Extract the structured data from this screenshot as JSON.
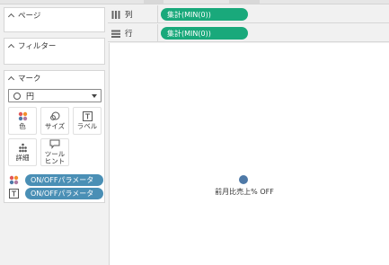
{
  "panels": {
    "pages": {
      "title": "ページ"
    },
    "filters": {
      "title": "フィルター"
    },
    "marks": {
      "title": "マーク",
      "mark_type": "円",
      "buttons": {
        "color": "色",
        "size": "サイズ",
        "label": "ラベル",
        "detail": "詳細",
        "tooltip": "ツールヒント"
      },
      "fields": [
        {
          "icon": "color-dots-icon",
          "label": "ON/OFFパラメータ"
        },
        {
          "icon": "text-label-icon",
          "label": "ON/OFFパラメータ"
        }
      ]
    }
  },
  "shelves": {
    "columns": {
      "label": "列",
      "pill": "集計(MIN(0))"
    },
    "rows": {
      "label": "行",
      "pill": "集計(MIN(0))"
    }
  },
  "view": {
    "mark_label": "前月比売上% OFF",
    "mark_color": "#4e79a7"
  },
  "colors": {
    "measure_pill": "#19a97b",
    "parameter_pill": "#4a8fb5"
  }
}
